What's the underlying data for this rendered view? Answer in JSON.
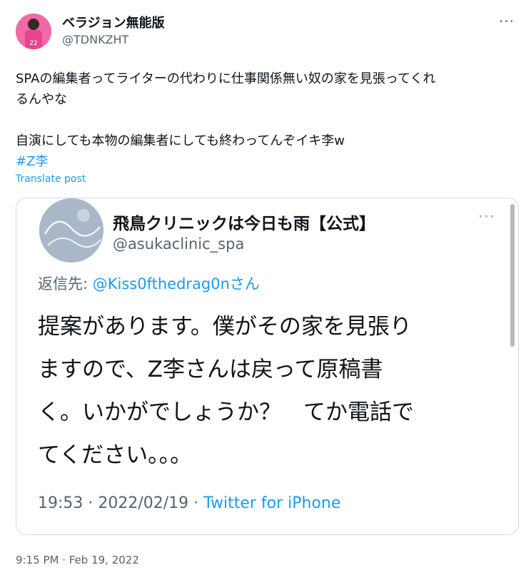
{
  "author": {
    "display_name": "ベラジョン無能版",
    "handle": "@TDNKZHT",
    "more_icon": "more-horizontal-icon"
  },
  "tweet": {
    "lines": [
      "SPAの編集者ってライターの代わりに仕事関係無い奴の家を見張ってくれ",
      "るんやな",
      "自演にしても本物の編集者にしても終わってんぞイキ李w"
    ],
    "hashtag": "#Z李",
    "translate": "Translate post"
  },
  "embedded": {
    "display_name": "飛鳥クリニックは今日も雨【公式】",
    "handle": "@asukaclinic_spa",
    "reply_prefix": "返信先: ",
    "reply_mention": "@Kiss0fthedrag0nさん",
    "body_lines": [
      "提案があります。僕がその家を見張り",
      "ますので、Z李さんは戻って原稿書",
      "く。いかがでしょうか？　てか電話で",
      "てください。。。"
    ],
    "time": "19:53 · 2022/02/19 · ",
    "source": "Twitter for iPhone"
  },
  "timestamp": "9:15 PM · Feb 19, 2022"
}
